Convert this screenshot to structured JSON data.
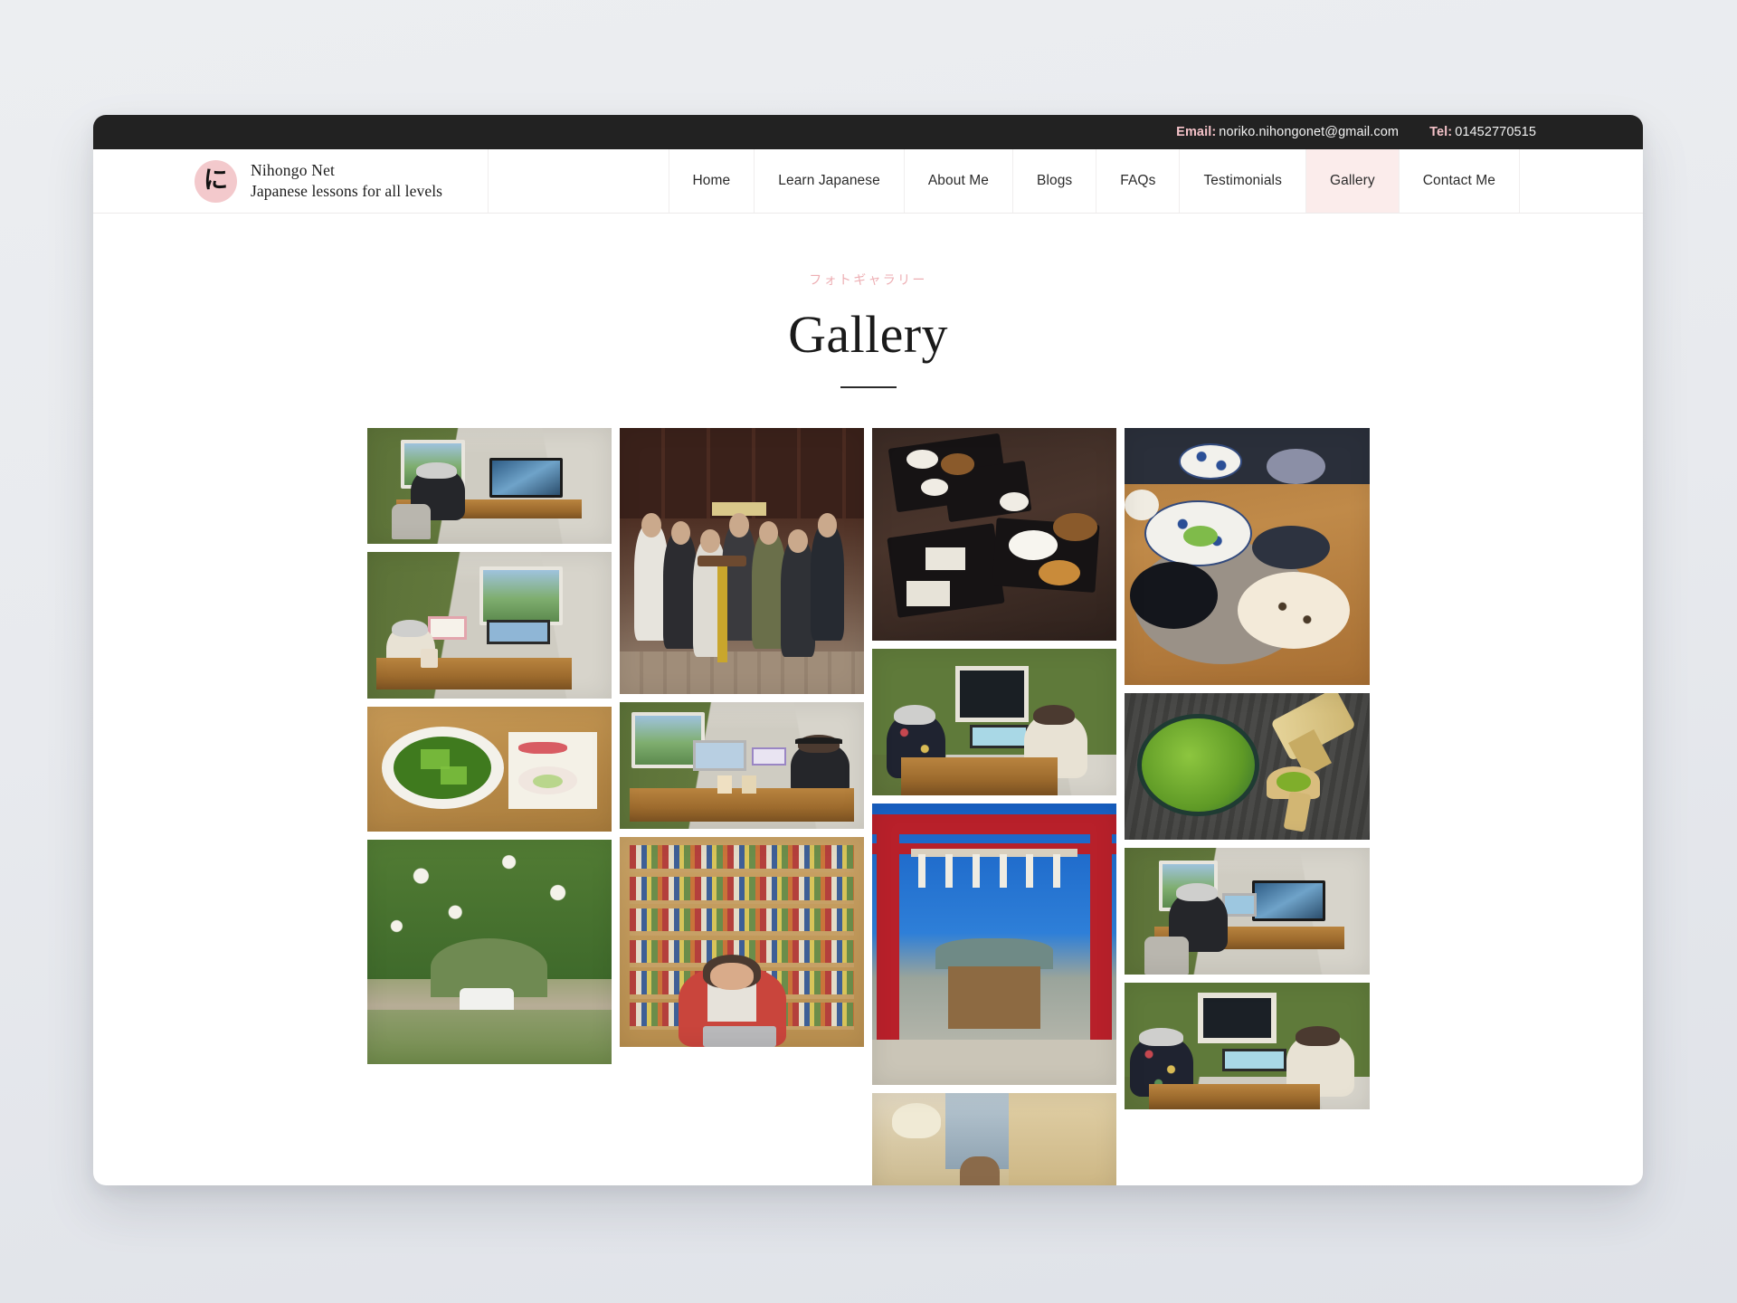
{
  "topbar": {
    "email_label": "Email:",
    "email_value": "noriko.nihongonet@gmail.com",
    "tel_label": "Tel:",
    "tel_value": "01452770515"
  },
  "brand": {
    "mark_glyph": "に",
    "title": "Nihongo Net",
    "subtitle": "Japanese lessons for all levels"
  },
  "nav": {
    "items": [
      {
        "label": "Home",
        "active": false
      },
      {
        "label": "Learn Japanese",
        "active": false
      },
      {
        "label": "About Me",
        "active": false
      },
      {
        "label": "Blogs",
        "active": false
      },
      {
        "label": "FAQs",
        "active": false
      },
      {
        "label": "Testimonials",
        "active": false
      },
      {
        "label": "Gallery",
        "active": true
      },
      {
        "label": "Contact Me",
        "active": false
      }
    ]
  },
  "page": {
    "eyebrow": "フォトギャラリー",
    "title": "Gallery"
  },
  "colors": {
    "accent_pink": "#f3c9cc",
    "accent_pink_soft": "#fbeceb",
    "eyebrow_pink": "#edaeb3",
    "topbar_dark": "#222222",
    "topbar_label_pink": "#f4c2c8",
    "page_background": "#e8eaee",
    "card_background": "#ffffff"
  },
  "gallery": {
    "columns": [
      {
        "items": [
          {
            "alt": "Teacher at desk with monitor in green study room",
            "scene": "study-back",
            "ratio": 0.475
          },
          {
            "alt": "Teacher holding flashcard during online lesson",
            "scene": "study-flashcard",
            "ratio": 0.6
          },
          {
            "alt": "Matcha jelly dessert with wagashi on wooden tray",
            "scene": "matcha-jelly",
            "ratio": 0.51
          },
          {
            "alt": "White rose garden arch with bench",
            "scene": "rose-garden",
            "ratio": 0.92
          }
        ]
      },
      {
        "items": [
          {
            "alt": "Group of students at a pub meetup",
            "scene": "pub-group",
            "ratio": 1.09
          },
          {
            "alt": "Student with headphones at desk during lesson",
            "scene": "study-headphones",
            "ratio": 0.52
          },
          {
            "alt": "Teacher speaking in front of bookshelf with laptop",
            "scene": "bookshelf",
            "ratio": 0.86
          }
        ]
      },
      {
        "items": [
          {
            "alt": "Japanese multi-course meal on black lacquer trays",
            "scene": "meal-trays",
            "ratio": 0.87
          },
          {
            "alt": "Teacher and student talking across a desk",
            "scene": "two-at-desk",
            "ratio": 0.6
          },
          {
            "alt": "Red torii gate leading to a shrine under blue sky",
            "scene": "torii",
            "ratio": 1.15
          },
          {
            "alt": "Interior hallway with hanging lamp",
            "scene": "hallway",
            "ratio": 0.42
          }
        ]
      },
      {
        "items": [
          {
            "alt": "Japanese home-style lunch on a wooden table",
            "scene": "meal-wood",
            "ratio": 1.05
          },
          {
            "alt": "Matcha bowl with bamboo whisk and powder on slate",
            "scene": "matcha-whisk",
            "ratio": 0.6
          },
          {
            "alt": "Teacher at desk with monitors seen from behind",
            "scene": "study-back-2",
            "ratio": 0.52
          },
          {
            "alt": "Teacher and student at desk with green wall",
            "scene": "two-at-desk-2",
            "ratio": 0.52
          }
        ]
      }
    ]
  }
}
